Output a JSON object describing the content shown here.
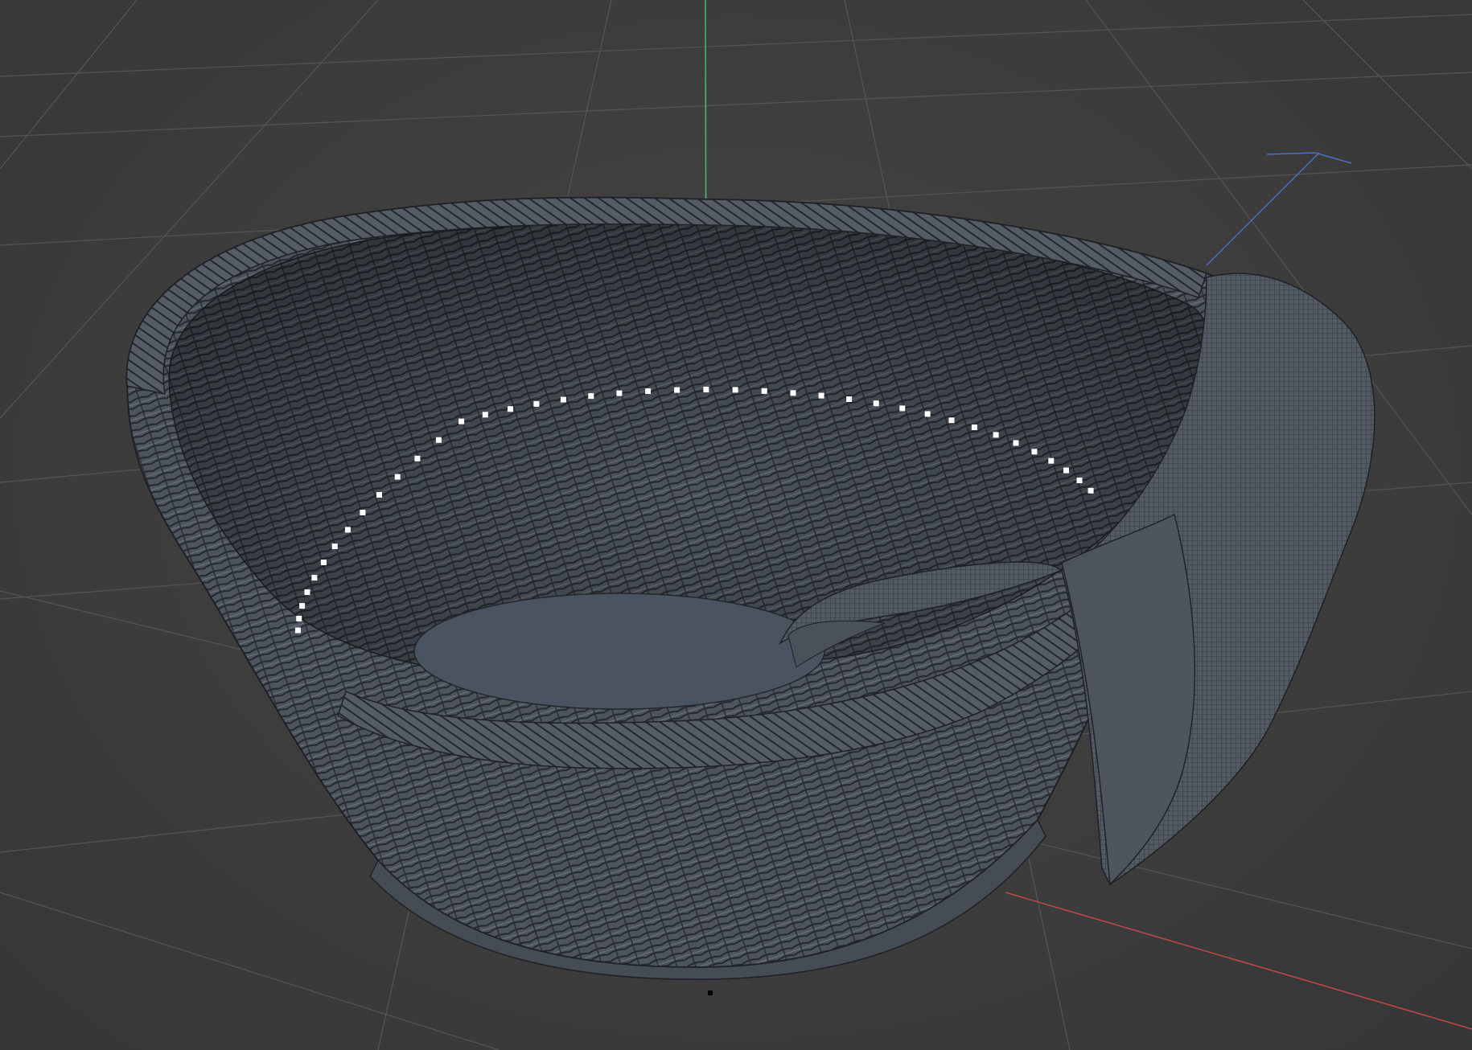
{
  "viewport": {
    "background": "#3d3d3d",
    "grid_color": "#5a5a5a",
    "axis_colors": {
      "y_axis": "#3fbf6a",
      "x_axis": "#c04848",
      "z_axis": "#4a72c0"
    },
    "shading": "wireframe-on-shaded",
    "mesh_color": "#4b525b",
    "wire_color": "#1c1f23",
    "highlight_color": "#ffffff"
  },
  "scene": {
    "objects": [
      {
        "name_icon": "wicker-basket-mesh"
      },
      {
        "name_icon": "cloth-napkin-mesh"
      }
    ]
  }
}
